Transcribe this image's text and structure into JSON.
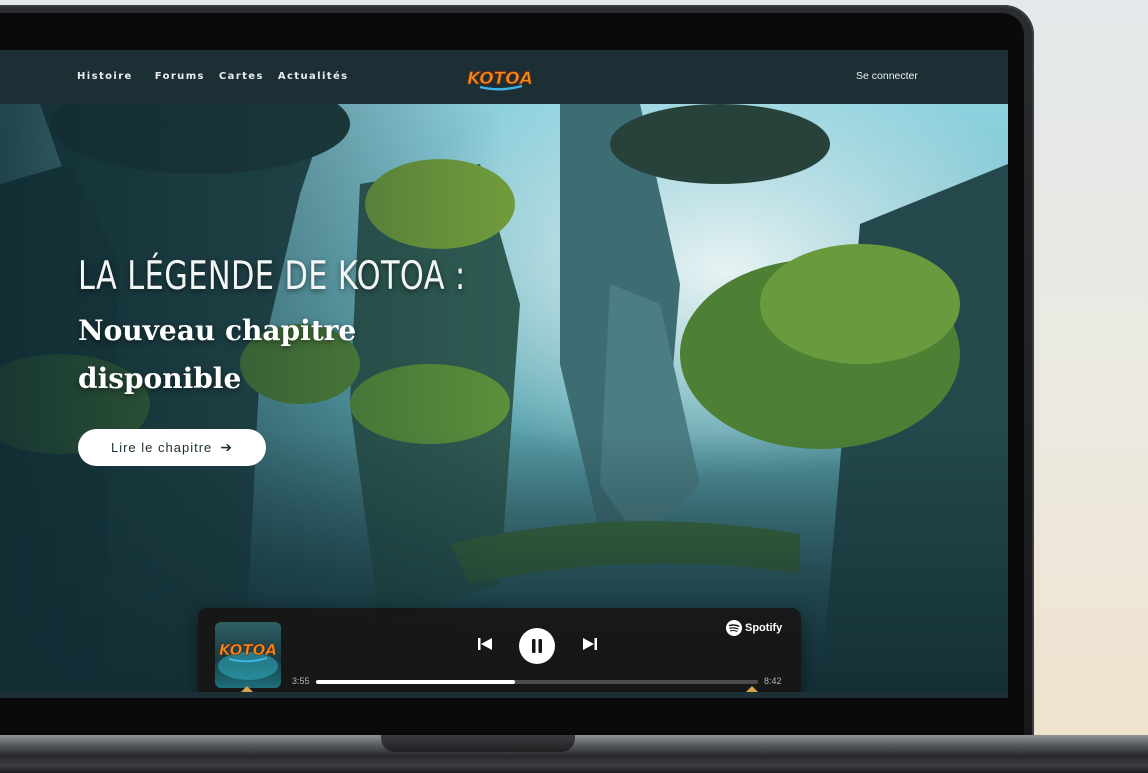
{
  "nav": {
    "links": [
      "Histoire",
      "Forums",
      "Cartes",
      "Actualités"
    ],
    "login": "Se connecter",
    "logo_text": "KOTOA"
  },
  "hero": {
    "kicker": "LA LÉGENDE DE KOTOA :",
    "title": "Nouveau chapitre disponible",
    "cta": "Lire le chapitre",
    "cta_icon": "arrow-right-icon"
  },
  "player": {
    "brand": "Spotify",
    "cover_text": "KOTOA",
    "current_time": "3:55",
    "duration": "8:42",
    "progress": 0.45,
    "state": "playing"
  },
  "colors": {
    "nav_bg": "#1c2f35",
    "logo_orange": "#f08a1c",
    "logo_blue": "#3fb3e6",
    "player_bg": "#161616",
    "marker_gold": "#d7a44a"
  }
}
